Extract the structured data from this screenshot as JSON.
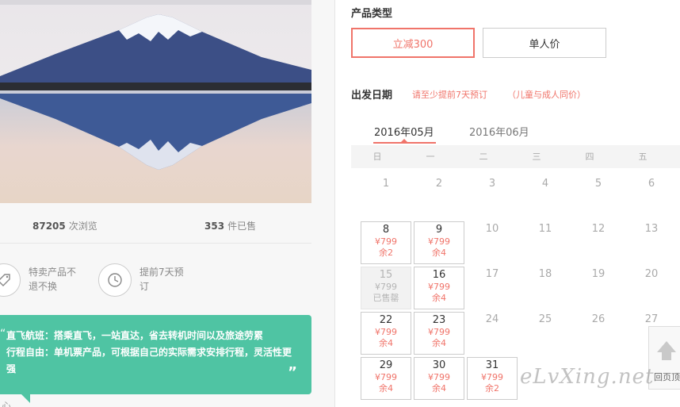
{
  "stats": {
    "views_count": "87205",
    "views_label": "次浏览",
    "sold_count": "353",
    "sold_label": "件已售"
  },
  "features": [
    {
      "icon": "tag-icon",
      "text": "特卖产品不退不换"
    },
    {
      "icon": "clock-icon",
      "text": "提前7天预订"
    }
  ],
  "promo": {
    "open_quote": "“",
    "close_quote": "”",
    "line1": "直飞航班：搭乘直飞，一站直达，省去转机时间以及旅途劳累",
    "line2": "行程自由：单机票产品，可根据自己的实际需求安排行程，灵活性更强",
    "below": "心"
  },
  "product_type": {
    "title": "产品类型",
    "options": [
      {
        "label": "立减300",
        "active": true
      },
      {
        "label": "单人价",
        "active": false
      }
    ]
  },
  "departure": {
    "title": "出发日期",
    "tip1": "请至少提前7天预订",
    "tip2": "（儿童与成人同价）"
  },
  "calendar": {
    "months": [
      {
        "label": "2016年05月",
        "active": true
      },
      {
        "label": "2016年06月",
        "active": false
      }
    ],
    "weekdays": [
      "日",
      "一",
      "二",
      "三",
      "四",
      "五"
    ],
    "rows": [
      [
        {
          "d": "1"
        },
        {
          "d": "2"
        },
        {
          "d": "3"
        },
        {
          "d": "4"
        },
        {
          "d": "5"
        },
        {
          "d": "6"
        }
      ],
      [
        {
          "d": "8",
          "price": "¥799",
          "remain": "余2"
        },
        {
          "d": "9",
          "price": "¥799",
          "remain": "余4"
        },
        {
          "d": "10"
        },
        {
          "d": "11"
        },
        {
          "d": "12"
        },
        {
          "d": "13"
        }
      ],
      [
        {
          "d": "15",
          "price": "¥799",
          "remain": "已售罄",
          "soldout": true
        },
        {
          "d": "16",
          "price": "¥799",
          "remain": "余4"
        },
        {
          "d": "17"
        },
        {
          "d": "18"
        },
        {
          "d": "19"
        },
        {
          "d": "20"
        }
      ],
      [
        {
          "d": "22",
          "price": "¥799",
          "remain": "余4"
        },
        {
          "d": "23",
          "price": "¥799",
          "remain": "余4"
        },
        {
          "d": "24"
        },
        {
          "d": "25"
        },
        {
          "d": "26"
        },
        {
          "d": "27"
        }
      ],
      [
        {
          "d": "29",
          "price": "¥799",
          "remain": "余4"
        },
        {
          "d": "30",
          "price": "¥799",
          "remain": "余4"
        },
        {
          "d": "31",
          "price": "¥799",
          "remain": "余2"
        }
      ]
    ]
  },
  "back_to_top": {
    "label": "回页顶"
  },
  "watermark": "eLvXing.net",
  "colors": {
    "accent": "#f0746a",
    "promo_bg": "#4fc4a3"
  }
}
